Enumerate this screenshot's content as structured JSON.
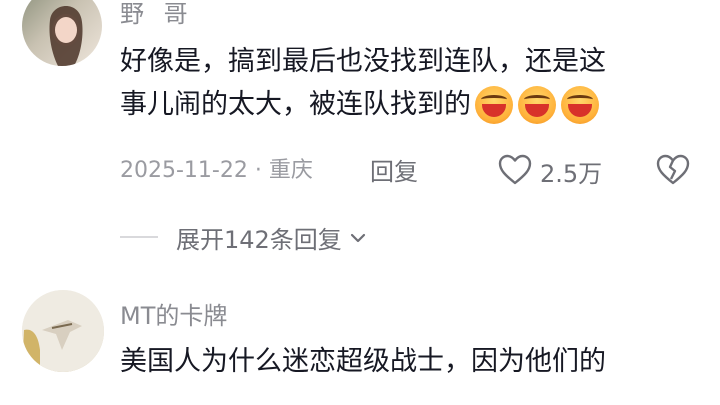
{
  "comments": [
    {
      "username": "野 哥",
      "text_line1": "好像是，搞到最后也没找到连队，还是这",
      "text_line2": "事儿闹的太大，被连队找到的",
      "emojis": [
        "grin-squint-icon",
        "grin-squint-icon",
        "grin-squint-icon"
      ],
      "date_location": "2025-11-22 · 重庆",
      "reply_label": "回复",
      "like_count": "2.5万",
      "expand_label": "展开142条回复"
    },
    {
      "username": "MT的卡牌",
      "text_line1": "美国人为什么迷恋超级战士，因为他们的"
    }
  ]
}
